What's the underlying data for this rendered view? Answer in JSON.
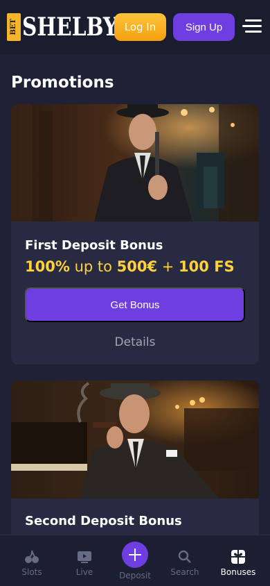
{
  "header": {
    "logo_badge": "BET",
    "logo_text": "SHELBY",
    "login_label": "Log In",
    "signup_label": "Sign Up",
    "menu_icon": "hamburger-icon"
  },
  "page": {
    "title": "Promotions"
  },
  "promotions": [
    {
      "title": "First Deposit Bonus",
      "offer_percent": "100%",
      "offer_upto": " up to ",
      "offer_amount": "500€",
      "offer_plus": " + ",
      "offer_fs": "100 FS",
      "button_label": "Get Bonus",
      "details_label": "Details"
    },
    {
      "title": "Second Deposit Bonus"
    }
  ],
  "bottom_nav": {
    "items": [
      {
        "label": "Slots",
        "icon": "cherries-icon"
      },
      {
        "label": "Live",
        "icon": "tv-play-icon"
      },
      {
        "label": "Deposit",
        "icon": "plus-icon"
      },
      {
        "label": "Search",
        "icon": "search-icon"
      },
      {
        "label": "Bonuses",
        "icon": "gift-icon"
      }
    ],
    "active": "Bonuses"
  },
  "colors": {
    "background": "#1f2236",
    "header": "#1a1d2e",
    "card": "#272a40",
    "accent_purple": "#6f3ee0",
    "accent_yellow": "#ffc43a",
    "offer_text": "#ffd23a"
  }
}
